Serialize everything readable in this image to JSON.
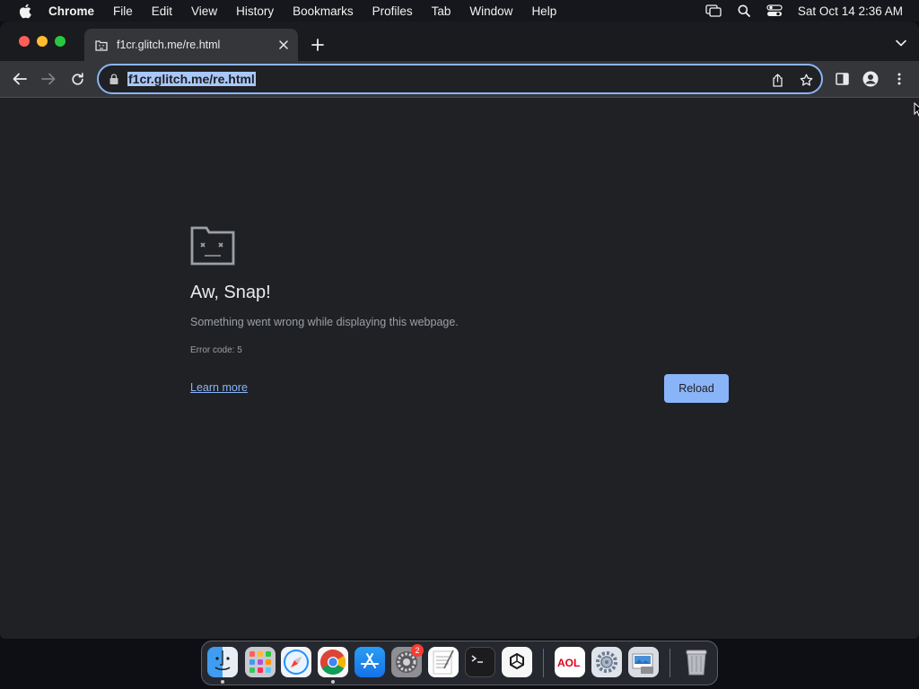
{
  "menubar": {
    "app_name": "Chrome",
    "items": [
      "File",
      "Edit",
      "View",
      "History",
      "Bookmarks",
      "Profiles",
      "Tab",
      "Window",
      "Help"
    ],
    "clock": "Sat Oct 14  2:36 AM"
  },
  "browser": {
    "tab_title": "f1cr.glitch.me/re.html",
    "url": "f1cr.glitch.me/re.html"
  },
  "error_page": {
    "title": "Aw, Snap!",
    "message": "Something went wrong while displaying this webpage.",
    "error_code": "Error code: 5",
    "learn_more": "Learn more",
    "reload": "Reload"
  },
  "dock": {
    "apps": [
      "finder-icon",
      "launchpad-icon",
      "safari-icon",
      "chrome-icon",
      "app-store-icon",
      "system-settings-icon",
      "textedit-icon",
      "terminal-icon",
      "chatgpt-icon",
      "aol-icon",
      "settings-gear-icon",
      "preview-icon",
      "trash-icon"
    ],
    "settings_badge": "2"
  },
  "colors": {
    "accent": "#8ab4f8",
    "page_bg": "#202124",
    "toolbar_bg": "#35363a"
  }
}
